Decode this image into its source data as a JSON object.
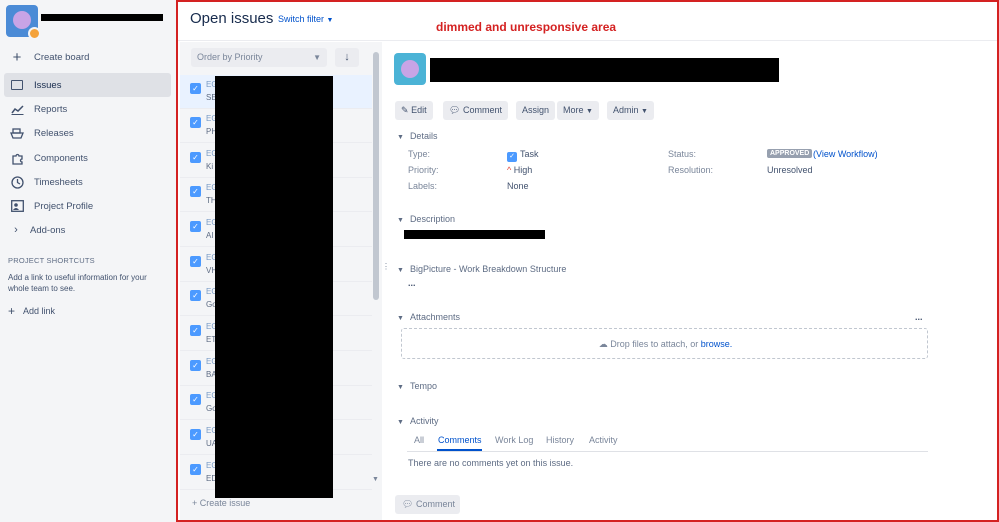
{
  "sidebar": {
    "nav": [
      {
        "label": "Create board",
        "icon": "plus-icon"
      },
      {
        "label": "Issues",
        "icon": "issues-icon",
        "active": true
      },
      {
        "label": "Reports",
        "icon": "chart-icon"
      },
      {
        "label": "Releases",
        "icon": "ship-icon"
      },
      {
        "label": "Components",
        "icon": "puzzle-icon"
      },
      {
        "label": "Timesheets",
        "icon": "clock-icon"
      },
      {
        "label": "Project Profile",
        "icon": "profile-icon"
      },
      {
        "label": "Add-ons",
        "icon": "chevron-right-icon"
      }
    ],
    "shortcuts_title": "PROJECT SHORTCUTS",
    "shortcuts_desc": "Add a link to useful information for your whole team to see.",
    "add_link": "Add link"
  },
  "header": {
    "title": "Open issues",
    "switch_filter": "Switch filter",
    "annotation": "dimmed and unresponsive area"
  },
  "list": {
    "order_by": "Order by Priority",
    "items": [
      {
        "key": "EG",
        "summary": "SE"
      },
      {
        "key": "EG",
        "summary": "PH"
      },
      {
        "key": "EG",
        "summary": "Ki"
      },
      {
        "key": "EG",
        "summary": "TH"
      },
      {
        "key": "EG",
        "summary": "AI"
      },
      {
        "key": "EG",
        "summary": "VH"
      },
      {
        "key": "EG",
        "summary": "Go"
      },
      {
        "key": "EG",
        "summary": "ET"
      },
      {
        "key": "EG",
        "summary": "BA"
      },
      {
        "key": "EG",
        "summary": "Go"
      },
      {
        "key": "EG",
        "summary": "UA"
      },
      {
        "key": "EG",
        "summary": "ED"
      }
    ],
    "create_issue": "Create issue"
  },
  "issue": {
    "actions": {
      "edit": "Edit",
      "comment": "Comment",
      "assign": "Assign",
      "more": "More",
      "admin": "Admin"
    },
    "details_title": "Details",
    "type_label": "Type:",
    "type_value": "Task",
    "priority_label": "Priority:",
    "priority_value": "High",
    "labels_label": "Labels:",
    "labels_value": "None",
    "status_label": "Status:",
    "status_value": "APPROVED",
    "view_workflow": "(View Workflow)",
    "resolution_label": "Resolution:",
    "resolution_value": "Unresolved",
    "description_title": "Description",
    "bigpicture_title": "BigPicture - Work Breakdown Structure",
    "bigpicture_value": "...",
    "attachments_title": "Attachments",
    "attachments_menu": "...",
    "drop_text": "Drop files to attach, or",
    "browse": "browse.",
    "tempo_title": "Tempo",
    "activity_title": "Activity",
    "activity_tabs": [
      "All",
      "Comments",
      "Work Log",
      "History",
      "Activity"
    ],
    "no_comments": "There are no comments yet on this issue.",
    "comment_button": "Comment"
  }
}
